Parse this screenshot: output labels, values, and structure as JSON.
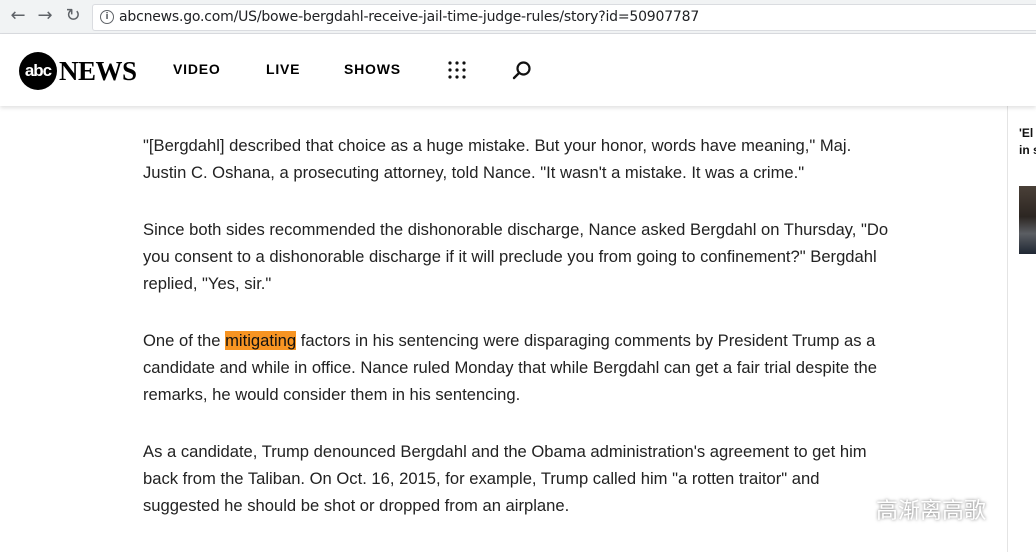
{
  "browser": {
    "back_icon": "back-arrow-icon",
    "forward_icon": "forward-arrow-icon",
    "reload_icon": "reload-icon",
    "url": "abcnews.go.com/US/bowe-bergdahl-receive-jail-time-judge-rules/story?id=50907787"
  },
  "header": {
    "logo_circle": "abc",
    "logo_word": "NEWS",
    "nav": {
      "video": "VIDEO",
      "live": "LIVE",
      "shows": "SHOWS"
    }
  },
  "article": {
    "p1": "\"[Bergdahl] described that choice as a huge mistake. But your honor, words have meaning,\" Maj. Justin C. Oshana, a prosecuting attorney, told Nance. \"It wasn't a mistake. It was a crime.\"",
    "p2": "Since both sides recommended the dishonorable discharge, Nance asked Bergdahl on Thursday, \"Do you consent to a dishonorable discharge if it will preclude you from going to confinement?\" Bergdahl replied, \"Yes, sir.\"",
    "p3_before": "One of the ",
    "p3_highlight": "mitigating",
    "p3_after": " factors in his sentencing were disparaging comments by President Trump as a candidate and while in office. Nance ruled Monday that while Bergdahl can get a fair trial despite the remarks, he would consider them in his sentencing.",
    "p4": "As a candidate, Trump denounced Bergdahl and the Obama administration's agreement to get him back from the Taliban. On Oct. 16, 2015, for example, Trump called him \"a rotten traitor\" and suggested he should be shot or dropped from an airplane."
  },
  "sidebar": {
    "teaser_line1": "'El",
    "teaser_line2": "in s"
  },
  "watermark": {
    "text": "高渐离高歌"
  },
  "colors": {
    "highlight": "#f79422",
    "text": "#222222",
    "brand": "#000000"
  }
}
